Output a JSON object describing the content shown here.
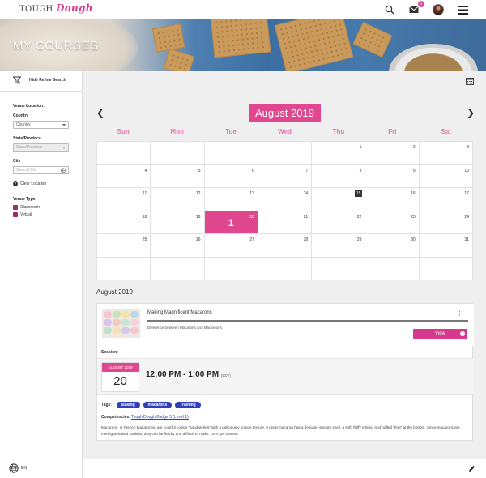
{
  "header": {
    "logo_part1": "TOUGH",
    "logo_part2": "Dough",
    "mail_count": "1"
  },
  "banner": {
    "title": "MY COURSES"
  },
  "sidebar": {
    "hide_refine": "Hide Refine Search",
    "venue_location": "Venue Location:",
    "country_label": "Country",
    "country_value": "Country",
    "state_label": "State/Province",
    "state_value": "State/Province",
    "city_label": "City",
    "city_placeholder": "Search City",
    "clear_location": "Clear Location",
    "venue_type": "Venue Type:",
    "venue_types": [
      "Classroom",
      "Virtual"
    ],
    "language": "EN"
  },
  "calendar": {
    "month_label": "August 2019",
    "days_of_week": [
      "Sun",
      "Mon",
      "Tue",
      "Wed",
      "Thu",
      "Fri",
      "Sat"
    ],
    "weeks": [
      [
        "",
        "",
        "",
        "",
        "1",
        "2",
        "3"
      ],
      [
        "4",
        "5",
        "6",
        "7",
        "8",
        "9",
        "10"
      ],
      [
        "11",
        "12",
        "13",
        "14",
        "15",
        "16",
        "17"
      ],
      [
        "18",
        "19",
        "20",
        "21",
        "22",
        "23",
        "24"
      ],
      [
        "25",
        "26",
        "27",
        "28",
        "29",
        "30",
        "31"
      ],
      [
        "",
        "",
        "",
        "",
        "",
        "",
        ""
      ]
    ],
    "today": "15",
    "event_day": "20",
    "event_count": "1"
  },
  "list": {
    "month_heading": "August 2019",
    "course": {
      "title": "Making Magnificent Macarons",
      "description": "Difference between Macarons and Macaroons",
      "view_label": "View",
      "session_label": "Session:",
      "date_month": "AUGUST 2019",
      "date_day": "20",
      "time": "12:00 PM - 1:00 PM",
      "timezone": "(EDT)",
      "tags_label": "Tags:",
      "tags": [
        "Baking",
        "macarons",
        "Training"
      ],
      "competencies_label": "Competencies:",
      "competency_link": "Tough Dough Badge 3 (Level 1)",
      "blurb": "Macarons, or French Macaroons, are colorful cookie \"sandwiches\" with a  deliciously unique texture. A great macaron has a delicate, smooth shell,  a soft, fluffy interior and ruffled \"feet\" at the bottom. Since macarons are meringue-based cookies, they can be finicky and difficult to make. Let's get started!"
    }
  },
  "colors": {
    "accent": "#e0478f",
    "tag": "#2e3fb8"
  }
}
